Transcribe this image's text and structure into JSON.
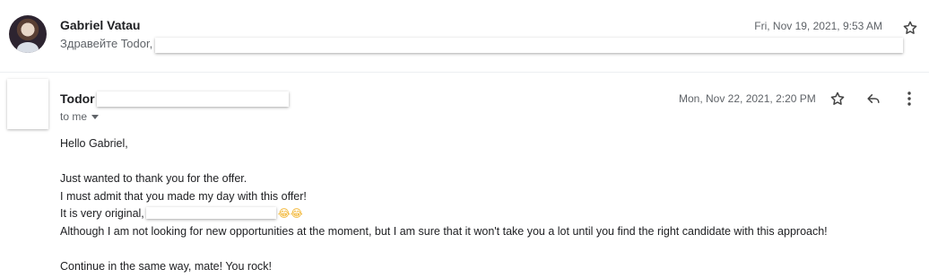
{
  "thread": {
    "message1": {
      "sender": "Gabriel Vatau",
      "snippet": "Здравейте Todor,",
      "date": "Fri, Nov 19, 2021, 9:53 AM"
    },
    "message2": {
      "sender": "Todor",
      "recipient": "to me",
      "date": "Mon, Nov 22, 2021, 2:20 PM",
      "body": {
        "greeting": "Hello Gabriel,",
        "line1": "Just wanted to thank you for the offer.",
        "line2": "I must admit that you made my day with this offer!",
        "line3_prefix": "It is very original,",
        "line3_emoji": "😂😂",
        "line4": "Although I am not looking for new opportunities at the moment, but I am sure that it won't take you a lot until you find the right candidate with this approach!",
        "line5": "Continue in the same way, mate! You rock!"
      }
    }
  },
  "icons": {
    "star": "star-outline-icon",
    "reply": "reply-icon",
    "more": "more-vertical-icon"
  }
}
